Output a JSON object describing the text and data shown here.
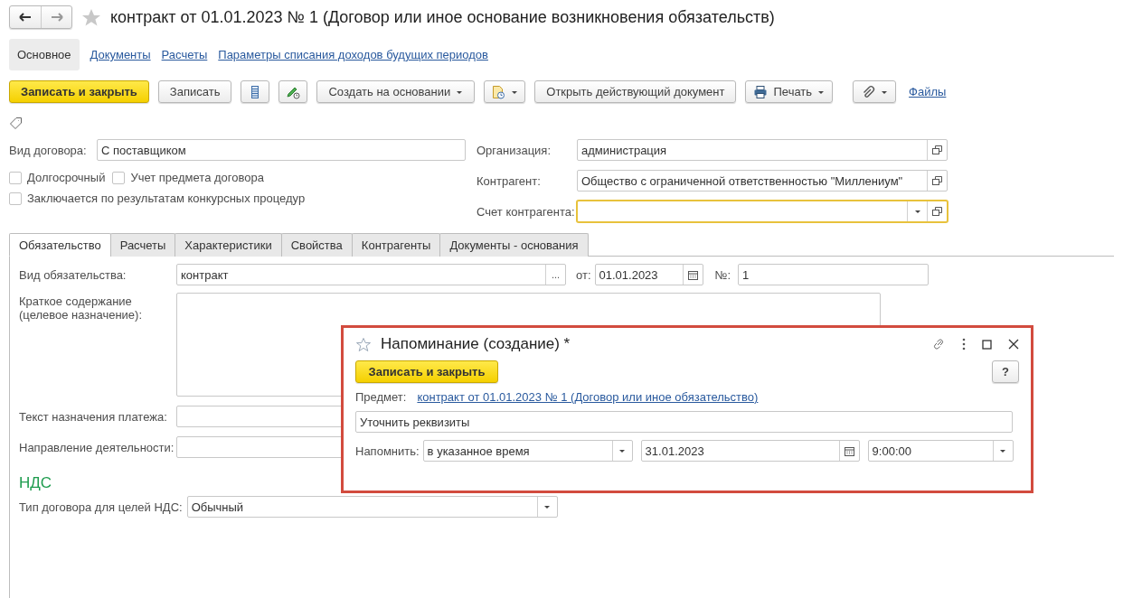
{
  "window": {
    "title": "контракт от 01.01.2023 № 1 (Договор или иное основание возникновения обязательств)"
  },
  "nav": [
    {
      "label": "Основное",
      "selected": true
    },
    {
      "label": "Документы",
      "selected": false
    },
    {
      "label": "Расчеты",
      "selected": false
    },
    {
      "label": "Параметры списания доходов будущих периодов",
      "selected": false
    }
  ],
  "toolbar": [
    {
      "kind": "primary",
      "label": "Записать и закрыть"
    },
    {
      "kind": "button",
      "label": "Записать"
    },
    {
      "kind": "list-icon"
    },
    {
      "kind": "pen-icon"
    },
    {
      "kind": "menu",
      "label": "Создать на основании"
    },
    {
      "kind": "report-menu"
    },
    {
      "kind": "button",
      "label": "Открыть действующий документ"
    },
    {
      "kind": "print-menu",
      "label": "Печать"
    },
    {
      "kind": "clip-menu"
    },
    {
      "kind": "link",
      "label": "Файлы"
    }
  ],
  "header_form": {
    "contract_type": {
      "label": "Вид договора:",
      "value": "С поставщиком"
    },
    "checkboxes": [
      {
        "label": "Долгосрочный",
        "checked": false
      },
      {
        "label": "Учет предмета договора",
        "checked": false
      },
      {
        "label": "Заключается по результатам конкурсных процедур",
        "checked": false
      }
    ],
    "organization": {
      "label": "Организация:",
      "value": "администрация"
    },
    "counterparty": {
      "label": "Контрагент:",
      "value": "Общество с ограниченной ответственностью \"Миллениум\""
    },
    "counterparty_account": {
      "label": "Счет контрагента:",
      "focused": true
    }
  },
  "tabs": [
    {
      "label": "Обязательство",
      "selected": true
    },
    {
      "label": "Расчеты",
      "selected": false
    },
    {
      "label": "Характеристики",
      "selected": false
    },
    {
      "label": "Свойства",
      "selected": false
    },
    {
      "label": "Контрагенты",
      "selected": false
    },
    {
      "label": "Документы - основания",
      "selected": false
    }
  ],
  "obligation": {
    "type": {
      "label": "Вид обязательства:",
      "value": "контракт",
      "select_button": "..."
    },
    "date": {
      "label": "от:",
      "value": "01.01.2023"
    },
    "number": {
      "label": "№:",
      "value": "1"
    },
    "summary": {
      "label": "Краткое содержание (целевое назначение):"
    },
    "payment_text": {
      "label": "Текст назначения платежа:"
    },
    "activity": {
      "label": "Направление деятельности:"
    }
  },
  "vat": {
    "heading": "НДС",
    "contract_type": {
      "label": "Тип договора для целей НДС:",
      "value": "Обычный"
    }
  },
  "reminder_dialog": {
    "title": "Напоминание (создание) *",
    "save_button": "Записать и закрыть",
    "help_button": "?",
    "subject": {
      "label": "Предмет:",
      "value": "контракт от 01.01.2023 № 1 (Договор или иное обязательство)"
    },
    "text": "Уточнить реквизиты",
    "remind": {
      "label": "Напомнить:",
      "mode": "в указанное время",
      "date": "31.01.2023",
      "time": "9:00:00"
    }
  }
}
